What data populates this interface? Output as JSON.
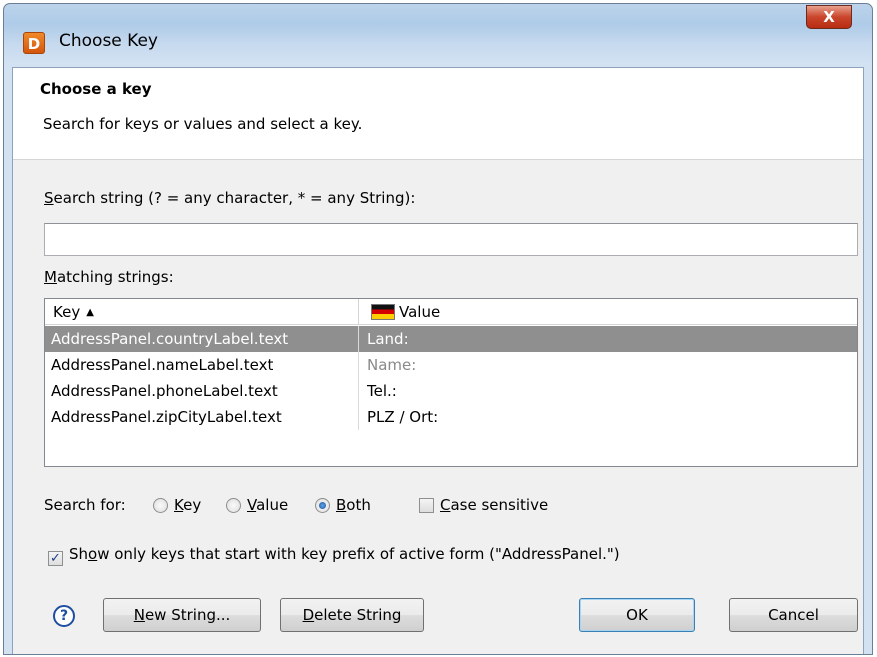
{
  "window": {
    "title": "Choose Key",
    "app_icon_text": "D",
    "close_label": "X"
  },
  "header": {
    "title": "Choose a key",
    "description": "Search for keys or values and select a key."
  },
  "search": {
    "label_mnemonic": "S",
    "label_rest": "earch string (? = any character, * = any String):",
    "value": "",
    "placeholder": ""
  },
  "matches": {
    "label_mnemonic": "M",
    "label_rest": "atching strings:",
    "columns": {
      "key": "Key",
      "value": "Value",
      "sort_indicator": "▲"
    },
    "rows": [
      {
        "key": "AddressPanel.countryLabel.text",
        "value": "Land:"
      },
      {
        "key": "AddressPanel.nameLabel.text",
        "value": "Name:"
      },
      {
        "key": "AddressPanel.phoneLabel.text",
        "value": "Tel.:"
      },
      {
        "key": "AddressPanel.zipCityLabel.text",
        "value": "PLZ / Ort:"
      }
    ],
    "selected_index": 0
  },
  "search_for": {
    "label": "Search for:",
    "options": [
      {
        "mnemonic": "K",
        "rest": "ey",
        "selected": false
      },
      {
        "mnemonic": "V",
        "rest": "alue",
        "selected": false
      },
      {
        "mnemonic": "B",
        "rest": "oth",
        "selected": true
      }
    ],
    "case_sensitive": {
      "mnemonic": "C",
      "rest": "ase sensitive",
      "checked": false
    }
  },
  "prefix_filter": {
    "pre": "Sh",
    "mnemonic": "o",
    "rest": "w only keys that start with key prefix of active form (\"AddressPanel.\")",
    "checked": true
  },
  "buttons": {
    "help": "?",
    "new_string_mnemonic": "N",
    "new_string_rest": "ew String...",
    "delete_string_mnemonic": "D",
    "delete_string_rest": "elete String",
    "ok": "OK",
    "cancel": "Cancel"
  },
  "colors": {
    "selection": "#8f8f8f",
    "titlebar": "#bcd3ea",
    "close_button": "#c9452b"
  }
}
